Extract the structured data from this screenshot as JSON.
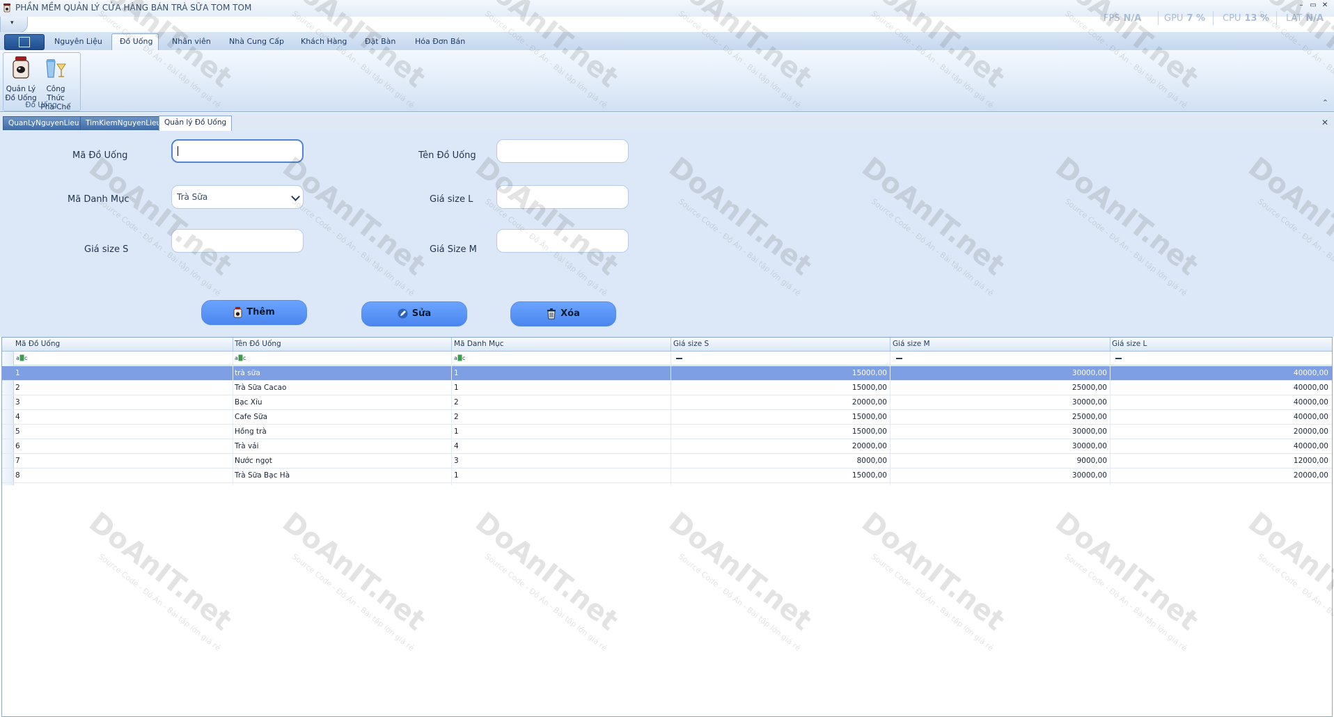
{
  "window": {
    "title": "PHẦN MỀM QUẢN LÝ CỬA HÀNG BÁN TRÀ SỮA TOM TOM",
    "stats": [
      {
        "label": "FPS",
        "value": "N/A"
      },
      {
        "label": "GPU",
        "value": "7 %"
      },
      {
        "label": "CPU",
        "value": "13 %"
      },
      {
        "label": "LAT",
        "value": "N/A"
      }
    ],
    "controls": {
      "minimize": "–",
      "maximize": "▭",
      "close": "✕"
    }
  },
  "qat": {
    "dropdown_glyph": "▾"
  },
  "ribbon": {
    "tabs": [
      "Nguyên Liệu",
      "Đồ Uống",
      "Nhân viên",
      "Nhà Cung Cấp",
      "Khách Hàng",
      "Đặt Bàn",
      "Hóa Đơn Bán"
    ],
    "active_tab": "Đồ Uống",
    "group": {
      "label": "Đồ Uống",
      "buttons": [
        {
          "line1": "Quản Lý",
          "line2": "Đồ Uống",
          "icon": "drink-manager-icon"
        },
        {
          "line1": "Công Thức",
          "line2": "Pha Chế",
          "icon": "recipe-icon"
        }
      ]
    },
    "collapse_glyph": "⌃"
  },
  "doc_tabs": {
    "items": [
      "QuanLyNguyenLieu",
      "TimKiemNguyenLieu",
      "Quản lý Đồ Uống"
    ],
    "active": "Quản lý Đồ Uống",
    "close_glyph": "✕"
  },
  "form": {
    "ma_do_uong": {
      "label": "Mã Đồ Uống",
      "value": ""
    },
    "ten_do_uong": {
      "label": "Tên Đồ Uống",
      "value": ""
    },
    "ma_danh_muc": {
      "label": "Mã Danh Mục",
      "value": "Trà Sữa"
    },
    "gia_size_l": {
      "label": "Giá size L",
      "value": ""
    },
    "gia_size_s": {
      "label": "Giá size S",
      "value": ""
    },
    "gia_size_m": {
      "label": "Giá Size M",
      "value": ""
    },
    "buttons": {
      "add": "Thêm",
      "edit": "Sửa",
      "delete": "Xóa"
    }
  },
  "grid": {
    "columns": [
      "Mã Đồ Uống",
      "Tên Đồ Uống",
      "Mã Danh Mục",
      "Giá size S",
      "Giá size M",
      "Giá size L"
    ],
    "filter_text_glyph": "a​🄱c",
    "selected_row": 0,
    "rows": [
      [
        "1",
        "trà sữa",
        "1",
        "15000,00",
        "30000,00",
        "40000,00"
      ],
      [
        "2",
        "Trà Sữa Cacao",
        "1",
        "15000,00",
        "25000,00",
        "40000,00"
      ],
      [
        "3",
        "Bạc Xỉu",
        "2",
        "20000,00",
        "30000,00",
        "40000,00"
      ],
      [
        "4",
        "Cafe Sữa",
        "2",
        "15000,00",
        "25000,00",
        "40000,00"
      ],
      [
        "5",
        "Hồng trà",
        "1",
        "15000,00",
        "30000,00",
        "20000,00"
      ],
      [
        "6",
        "Trà vải",
        "4",
        "20000,00",
        "30000,00",
        "40000,00"
      ],
      [
        "7",
        "Nước ngọt",
        "3",
        "8000,00",
        "9000,00",
        "12000,00"
      ],
      [
        "8",
        "Trà Sữa Bạc Hà",
        "1",
        "15000,00",
        "30000,00",
        "20000,00"
      ]
    ]
  },
  "watermark": {
    "brand": "DoAnIT.net",
    "tagline": "Source Code - Đồ Án - Bài tập lớn giá rẻ"
  },
  "colors": {
    "accent_button": "#5a95f7",
    "selected_row": "#7f9fe4",
    "form_bg": "#dce8f7"
  }
}
